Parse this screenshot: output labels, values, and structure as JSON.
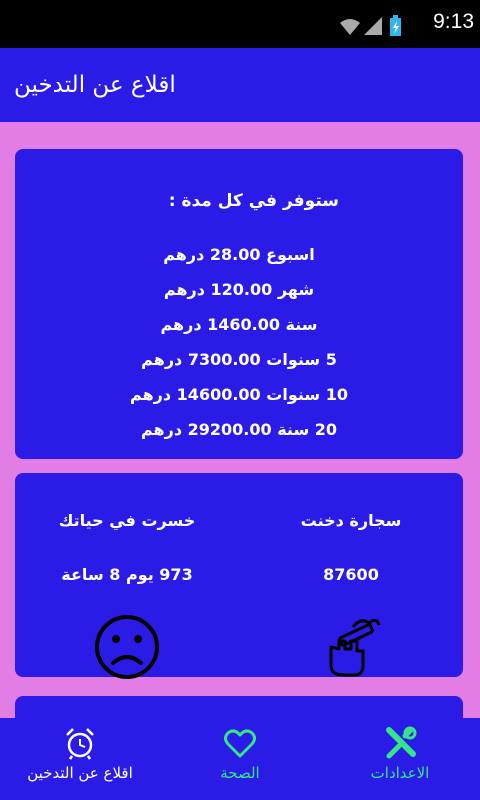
{
  "status_bar": {
    "time": "9:13"
  },
  "app_bar": {
    "title": "اقلاع عن التدخين"
  },
  "savings_card": {
    "heading": "ستوفر في كل مدة :",
    "rows": [
      "اسبوع 28.00 درهم",
      "شهر 120.00 درهم",
      "سنة 1460.00 درهم",
      "5 سنوات 7300.00 درهم",
      "10 سنوات 14600.00 درهم",
      "20 سنة 29200.00 درهم"
    ]
  },
  "stats_card": {
    "cigarettes_label": "سجارة دخنت",
    "cigarettes_value": "87600",
    "lost_label": "خسرت في حياتك",
    "lost_value": "973 يوم 8 ساعة"
  },
  "bottom_nav": {
    "tabs": [
      {
        "label": "اقلاع عن التدخين",
        "icon": "alarm-clock-icon"
      },
      {
        "label": "الصحة",
        "icon": "heart-icon"
      },
      {
        "label": "الاعدادات",
        "icon": "tools-icon"
      }
    ]
  },
  "colors": {
    "background": "#e27de6",
    "primary": "#2a1ce6",
    "accent": "#34e68a",
    "status_bar": "#000000"
  }
}
